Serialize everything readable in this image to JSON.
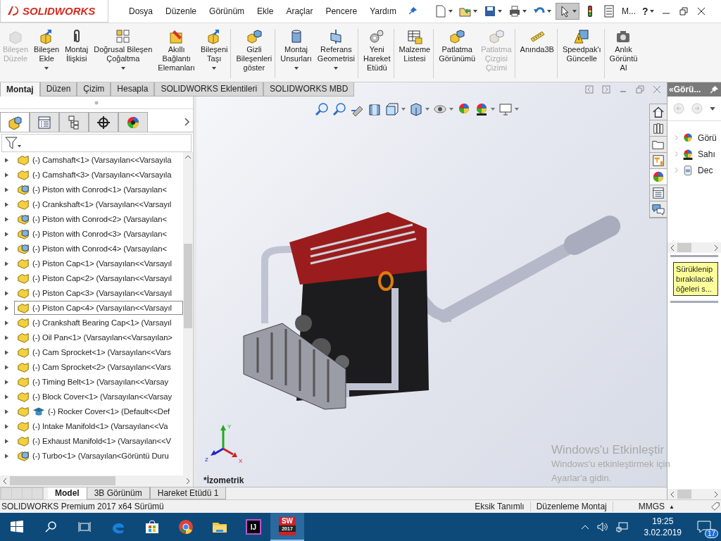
{
  "app": {
    "logo": "SOLIDWORKS"
  },
  "menu": [
    "Dosya",
    "Düzenle",
    "Görünüm",
    "Ekle",
    "Araçlar",
    "Pencere",
    "Yardım"
  ],
  "quick_toolbar": [
    {
      "kind": "new",
      "dropdown": true,
      "selected": false
    },
    {
      "kind": "open",
      "dropdown": true,
      "selected": false
    },
    {
      "kind": "save",
      "dropdown": true,
      "selected": false
    },
    {
      "kind": "print",
      "dropdown": true,
      "selected": false
    },
    {
      "kind": "undo",
      "dropdown": true,
      "selected": false
    },
    {
      "kind": "select",
      "dropdown": true,
      "selected": true
    },
    {
      "kind": "rebuild",
      "dropdown": false,
      "selected": false
    },
    {
      "kind": "options",
      "dropdown": false,
      "selected": false
    }
  ],
  "quick_text": "M...",
  "help": {
    "label": "?",
    "dropdown": true
  },
  "ribbon": [
    {
      "kind": "edit-component",
      "lines": [
        "Bileşen",
        "Düzele"
      ],
      "disabled": true,
      "dropdown": false,
      "divider": false
    },
    {
      "kind": "insert",
      "lines": [
        "Bileşen",
        "Ekle"
      ],
      "disabled": false,
      "dropdown": true,
      "divider": false
    },
    {
      "kind": "mate",
      "lines": [
        "Montaj",
        "İlişkisi"
      ],
      "disabled": false,
      "dropdown": false,
      "divider": false
    },
    {
      "kind": "pattern",
      "lines": [
        "Doğrusal Bileşen",
        "Çoğaltma"
      ],
      "disabled": false,
      "dropdown": true,
      "divider": false
    },
    {
      "kind": "fastener",
      "lines": [
        "Akıllı",
        "Bağlantı",
        "Elemanları"
      ],
      "disabled": false,
      "dropdown": false,
      "divider": false
    },
    {
      "kind": "move",
      "lines": [
        "Bileşeni",
        "Taşı"
      ],
      "disabled": false,
      "dropdown": true,
      "divider": true
    },
    {
      "kind": "show-hidden",
      "lines": [
        "Gizli",
        "Bileşenleri",
        "göster"
      ],
      "disabled": false,
      "dropdown": false,
      "divider": true
    },
    {
      "kind": "features",
      "lines": [
        "Montaj",
        "Unsurları"
      ],
      "disabled": false,
      "dropdown": true,
      "divider": false
    },
    {
      "kind": "reference",
      "lines": [
        "Referans",
        "Geometrisi"
      ],
      "disabled": false,
      "dropdown": true,
      "divider": true
    },
    {
      "kind": "motion",
      "lines": [
        "Yeni",
        "Hareket",
        "Etüdü"
      ],
      "disabled": false,
      "dropdown": false,
      "divider": true
    },
    {
      "kind": "bom",
      "lines": [
        "Malzeme",
        "Listesi"
      ],
      "disabled": false,
      "dropdown": false,
      "divider": true
    },
    {
      "kind": "explode",
      "lines": [
        "Patlatma",
        "Görünümü"
      ],
      "disabled": false,
      "dropdown": false,
      "divider": false
    },
    {
      "kind": "explode-line",
      "lines": [
        "Patlatma",
        "Çizgisi",
        "Çizimi"
      ],
      "disabled": true,
      "dropdown": false,
      "divider": true
    },
    {
      "kind": "instant3d",
      "lines": [
        "Anında3B"
      ],
      "disabled": false,
      "dropdown": false,
      "divider": true
    },
    {
      "kind": "speedpak",
      "lines": [
        "Speedpak'ı",
        "Güncelle"
      ],
      "disabled": false,
      "dropdown": false,
      "divider": true
    },
    {
      "kind": "snapshot",
      "lines": [
        "Anlık",
        "Görüntü",
        "Al"
      ],
      "disabled": false,
      "dropdown": false,
      "divider": false
    }
  ],
  "command_tabs": [
    {
      "label": "Montaj",
      "selected": true
    },
    {
      "label": "Düzen",
      "selected": false
    },
    {
      "label": "Çizim",
      "selected": false
    },
    {
      "label": "Hesapla",
      "selected": false
    },
    {
      "label": "SOLIDWORKS Eklentileri",
      "selected": false
    },
    {
      "label": "SOLIDWORKS MBD",
      "selected": false
    }
  ],
  "manager_tabs": [
    {
      "kind": "feature-tree",
      "selected": true
    },
    {
      "kind": "property",
      "selected": false
    },
    {
      "kind": "configuration",
      "selected": false
    },
    {
      "kind": "dimxpert",
      "selected": false
    },
    {
      "kind": "display",
      "selected": false
    }
  ],
  "tree": [
    {
      "text": "(-) Camshaft<1>  (Varsayılan<<Varsayıla",
      "kind": "part",
      "extra_icon": false,
      "selected": false
    },
    {
      "text": "(-) Camshaft<3>  (Varsayılan<<Varsayıla",
      "kind": "part",
      "extra_icon": false,
      "selected": false
    },
    {
      "text": "(-) Piston with Conrod<1>  (Varsayılan<",
      "kind": "assembly",
      "extra_icon": false,
      "selected": false
    },
    {
      "text": "(-) Crankshaft<1>  (Varsayılan<<Varsayıl",
      "kind": "part",
      "extra_icon": false,
      "selected": false
    },
    {
      "text": "(-) Piston with Conrod<2>  (Varsayılan<",
      "kind": "assembly",
      "extra_icon": false,
      "selected": false
    },
    {
      "text": "(-) Piston with Conrod<3>  (Varsayılan<",
      "kind": "assembly",
      "extra_icon": false,
      "selected": false
    },
    {
      "text": "(-) Piston with Conrod<4>  (Varsayılan<",
      "kind": "assembly",
      "extra_icon": false,
      "selected": false
    },
    {
      "text": "(-) Piston Cap<1>  (Varsayılan<<Varsayıl",
      "kind": "part",
      "extra_icon": false,
      "selected": false
    },
    {
      "text": "(-) Piston Cap<2>  (Varsayılan<<Varsayıl",
      "kind": "part",
      "extra_icon": false,
      "selected": false
    },
    {
      "text": "(-) Piston Cap<3>  (Varsayılan<<Varsayıl",
      "kind": "part",
      "extra_icon": false,
      "selected": false
    },
    {
      "text": "(-) Piston Cap<4>  (Varsayılan<<Varsayıl",
      "kind": "part",
      "extra_icon": false,
      "selected": true
    },
    {
      "text": "(-) Crankshaft Bearing Cap<1>  (Varsayıl",
      "kind": "part",
      "extra_icon": false,
      "selected": false
    },
    {
      "text": "(-) Oil Pan<1>  (Varsayılan<<Varsayılan>",
      "kind": "part",
      "extra_icon": false,
      "selected": false
    },
    {
      "text": "(-) Cam Sprocket<1>  (Varsayılan<<Vars",
      "kind": "part",
      "extra_icon": false,
      "selected": false
    },
    {
      "text": "(-) Cam Sprocket<2>  (Varsayılan<<Vars",
      "kind": "part",
      "extra_icon": false,
      "selected": false
    },
    {
      "text": "(-) Timing Belt<1>  (Varsayılan<<Varsay",
      "kind": "part",
      "extra_icon": false,
      "selected": false
    },
    {
      "text": "(-) Block Cover<1>  (Varsayılan<<Varsay",
      "kind": "part",
      "extra_icon": false,
      "selected": false
    },
    {
      "text": "(-) Rocker Cover<1>  (Default<<Def",
      "kind": "part",
      "extra_icon": true,
      "selected": false
    },
    {
      "text": "(-) Intake Manifold<1>  (Varsayılan<<Va",
      "kind": "part",
      "extra_icon": false,
      "selected": false
    },
    {
      "text": "(-) Exhaust Manifold<1>  (Varsayılan<<V",
      "kind": "part",
      "extra_icon": false,
      "selected": false
    },
    {
      "text": "(-) Turbo<1>  (Varsayılan<Görüntü Duru",
      "kind": "assembly",
      "extra_icon": false,
      "selected": false
    }
  ],
  "model_tabs": [
    {
      "label": "Model",
      "selected": true
    },
    {
      "label": "3B Görünüm",
      "selected": false
    },
    {
      "label": "Hareket Etüdü 1",
      "selected": false
    }
  ],
  "heads_up": [
    {
      "kind": "zoom-fit",
      "dropdown": false
    },
    {
      "kind": "zoom-area",
      "dropdown": false
    },
    {
      "kind": "previous-view",
      "dropdown": false
    },
    {
      "kind": "section",
      "dropdown": false
    },
    {
      "kind": "orientation",
      "dropdown": true
    },
    {
      "kind": "display-style",
      "dropdown": true
    },
    {
      "kind": "hide-show",
      "dropdown": true
    },
    {
      "kind": "appearance",
      "dropdown": false
    },
    {
      "kind": "scene",
      "dropdown": true
    },
    {
      "kind": "view-settings",
      "dropdown": true
    }
  ],
  "viewport": {
    "view_name": "*İzometrik",
    "triad": {
      "x": "X",
      "y": "Y",
      "z": "Z"
    }
  },
  "activation": {
    "title": "Windows'u Etkinleştir",
    "lines": [
      "Windows'u etkinleştirmek için",
      "Ayarlar'a gidin."
    ]
  },
  "task_tabs": [
    {
      "kind": "home",
      "selected": false
    },
    {
      "kind": "library",
      "selected": false
    },
    {
      "kind": "folder",
      "selected": false
    },
    {
      "kind": "palette",
      "selected": false
    },
    {
      "kind": "appearance",
      "selected": true
    },
    {
      "kind": "properties",
      "selected": false
    },
    {
      "kind": "forum",
      "selected": false
    }
  ],
  "task_pane": {
    "title": "«Görü...",
    "items": [
      {
        "label": "Görü",
        "kind": "appearances"
      },
      {
        "label": "Sahı",
        "kind": "scenes"
      },
      {
        "label": "Dec",
        "kind": "decals"
      }
    ],
    "note": "Sürüklenip bırakılacak öğeleri s..."
  },
  "status_bar": {
    "version": "SOLIDWORKS Premium 2017 x64 Sürümü",
    "state": "Eksik Tanımlı",
    "mode": "Düzenleme Montaj",
    "units": "MMGS",
    "units_arrow": "▲"
  },
  "taskbar": {
    "apps": [
      {
        "kind": "edge",
        "active": false
      },
      {
        "kind": "store",
        "active": false
      },
      {
        "kind": "chrome",
        "active": false
      },
      {
        "kind": "explorer",
        "active": false
      },
      {
        "kind": "intellij",
        "active": false
      },
      {
        "kind": "solidworks",
        "active": true
      }
    ],
    "sw_text": "SW",
    "sw_year": "2017",
    "ij_text": "IJ",
    "time": "19:25",
    "date": "3.02.2019",
    "notifications": "17"
  }
}
